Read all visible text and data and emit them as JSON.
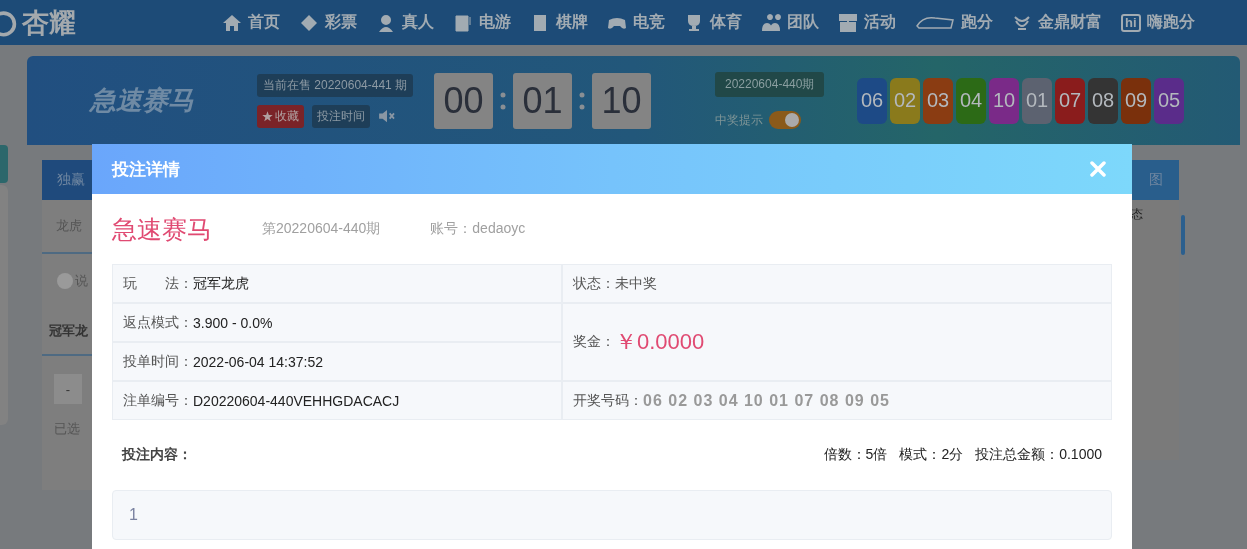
{
  "nav": {
    "logo": "杏耀",
    "items": [
      {
        "label": "首页"
      },
      {
        "label": "彩票"
      },
      {
        "label": "真人"
      },
      {
        "label": "电游"
      },
      {
        "label": "棋牌"
      },
      {
        "label": "电竞"
      },
      {
        "label": "体育"
      },
      {
        "label": "团队"
      },
      {
        "label": "活动"
      },
      {
        "label": "跑分"
      },
      {
        "label": "金鼎财富"
      },
      {
        "label": "嗨跑分",
        "icon_text": "hi"
      }
    ]
  },
  "game_bar": {
    "logo": "急速赛马",
    "current_issue": "当前在售 20220604-441 期",
    "favorite_button": "收藏",
    "bet_time_button": "投注时间",
    "muted": true,
    "countdown": [
      "00",
      "01",
      "10"
    ],
    "last_issue": "20220604-440期",
    "win_alert": {
      "label": "中奖提示",
      "on": true
    },
    "balls": [
      {
        "number": "06",
        "color": "#1d4a86"
      },
      {
        "number": "02",
        "color": "#8a7a1c"
      },
      {
        "number": "03",
        "color": "#8a3c12"
      },
      {
        "number": "04",
        "color": "#2c6a16"
      },
      {
        "number": "10",
        "color": "#7a2a88"
      },
      {
        "number": "01",
        "color": "#5c6270"
      },
      {
        "number": "07",
        "color": "#8a1c1c"
      },
      {
        "number": "08",
        "color": "#343434"
      },
      {
        "number": "09",
        "color": "#7a300c"
      },
      {
        "number": "05",
        "color": "#5a2c8a"
      }
    ]
  },
  "background": {
    "tab": "独赢",
    "row": "龙虎",
    "note": "说",
    "section": "冠军龙",
    "minus": "-",
    "selected_label": "已选",
    "right_tab": "图",
    "right_header": "态"
  },
  "modal": {
    "title": "投注详情",
    "game": "急速赛马",
    "issue": "第20220604-440期",
    "account": "账号：dedaoyc",
    "details": {
      "play": {
        "label": "玩　　法：",
        "value": "冠军龙虎"
      },
      "status": {
        "label": "状态：",
        "value": "未中奖"
      },
      "rebate": {
        "label": "返点模式：",
        "value": "3.900 - 0.0%"
      },
      "prize": {
        "label": "奖金：",
        "value": "￥0.0000"
      },
      "bet_time": {
        "label": "投单时间：",
        "value": "2022-06-04 14:37:52"
      },
      "order_no": {
        "label": "注单编号：",
        "value": "D20220604-440VEHHGDACACJ"
      },
      "draw_numbers": {
        "label": "开奖号码：",
        "value": "06 02 03 04 10 01 07 08 09 05"
      }
    },
    "content_label": "投注内容：",
    "summary": [
      "倍数：5倍",
      "模式：2分",
      "投注总金额：0.1000"
    ],
    "content": "1"
  }
}
